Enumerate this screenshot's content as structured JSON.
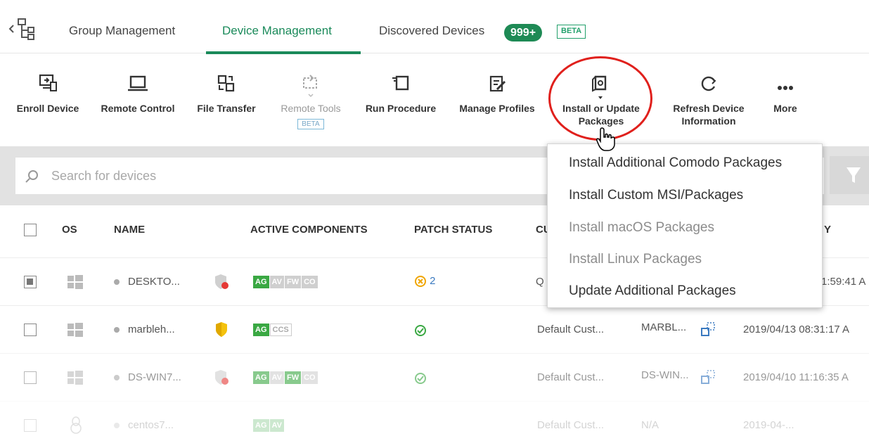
{
  "tabs": {
    "group_management": "Group Management",
    "device_management": "Device Management",
    "discovered_devices": "Discovered Devices",
    "discovered_count": "999+",
    "beta": "BETA"
  },
  "toolbar": {
    "enroll_device": "Enroll Device",
    "remote_control": "Remote Control",
    "file_transfer": "File Transfer",
    "remote_tools": "Remote Tools",
    "remote_tools_beta": "BETA",
    "run_procedure": "Run Procedure",
    "manage_profiles": "Manage Profiles",
    "install_update_line1": "Install or Update",
    "install_update_line2": "Packages",
    "refresh_line1": "Refresh Device",
    "refresh_line2": "Information",
    "more": "More"
  },
  "search": {
    "placeholder": "Search for devices"
  },
  "table": {
    "headers": {
      "os": "OS",
      "name": "NAME",
      "active_components": "ACTIVE COMPONENTS",
      "patch_status": "PATCH STATUS",
      "customer_partial": "CU",
      "last_activity_partial": "Y"
    },
    "rows": [
      {
        "name": "DESKTO...",
        "components": [
          "AG",
          "AV",
          "FW",
          "CO"
        ],
        "patch": "2",
        "customer": "Q",
        "last_activity": "1:59:41 A"
      },
      {
        "name": "marbleh...",
        "components": [
          "AG",
          "CCS"
        ],
        "customer": "Default Cust...",
        "device_name": "MARBL...",
        "last_activity": "2019/04/13 08:31:17 A"
      },
      {
        "name": "DS-WIN7...",
        "components": [
          "AG",
          "AV",
          "FW",
          "CO"
        ],
        "customer": "Default Cust...",
        "device_name": "DS-WIN...",
        "last_activity": "2019/04/10 11:16:35 A"
      },
      {
        "name": "centos7...",
        "components": [
          "AG",
          "AV"
        ],
        "customer": "Default Cust...",
        "device_name": "N/A",
        "last_activity": "2019-04-..."
      }
    ]
  },
  "dropdown": {
    "items": [
      "Install Additional Comodo Packages",
      "Install Custom MSI/Packages",
      "Install macOS Packages",
      "Install Linux Packages",
      "Update Additional Packages"
    ]
  },
  "colors": {
    "accent": "#1a8a5a",
    "highlight_ring": "#e0201c",
    "component_on": "#3aa843"
  }
}
